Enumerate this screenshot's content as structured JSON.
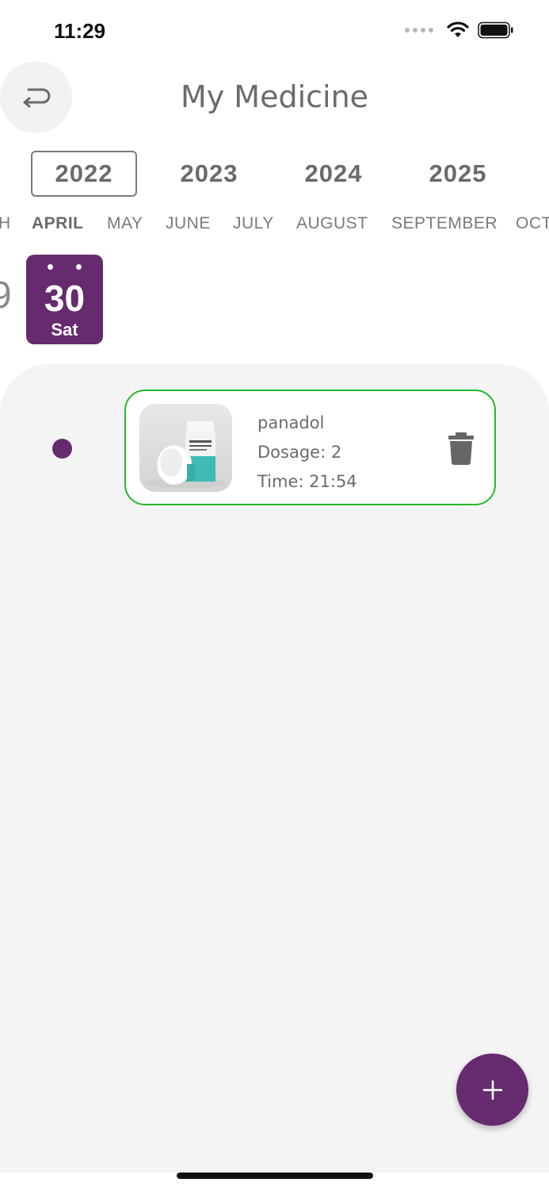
{
  "status_bar": {
    "time": "11:29"
  },
  "header": {
    "title": "My Medicine",
    "back_icon": "back-return-icon"
  },
  "years": [
    {
      "label": "2022",
      "selected": true
    },
    {
      "label": "2023",
      "selected": false
    },
    {
      "label": "2024",
      "selected": false
    },
    {
      "label": "2025",
      "selected": false
    }
  ],
  "months": [
    {
      "label": "H",
      "selected": false
    },
    {
      "label": "APRIL",
      "selected": true
    },
    {
      "label": "MAY",
      "selected": false
    },
    {
      "label": "JUNE",
      "selected": false
    },
    {
      "label": "JULY",
      "selected": false
    },
    {
      "label": "AUGUST",
      "selected": false
    },
    {
      "label": "SEPTEMBER",
      "selected": false
    },
    {
      "label": "OCT",
      "selected": false
    }
  ],
  "days": {
    "previous_partial": "9",
    "selected": {
      "number": "30",
      "name": "Sat"
    }
  },
  "medicines": [
    {
      "name": "panadol",
      "dosage": "Dosage: 2",
      "time": "Time: 21:54",
      "border_color": "#25b72c"
    }
  ],
  "colors": {
    "accent": "#662a6f",
    "card_border": "#25b72c"
  },
  "fab": {
    "icon": "plus-icon"
  }
}
